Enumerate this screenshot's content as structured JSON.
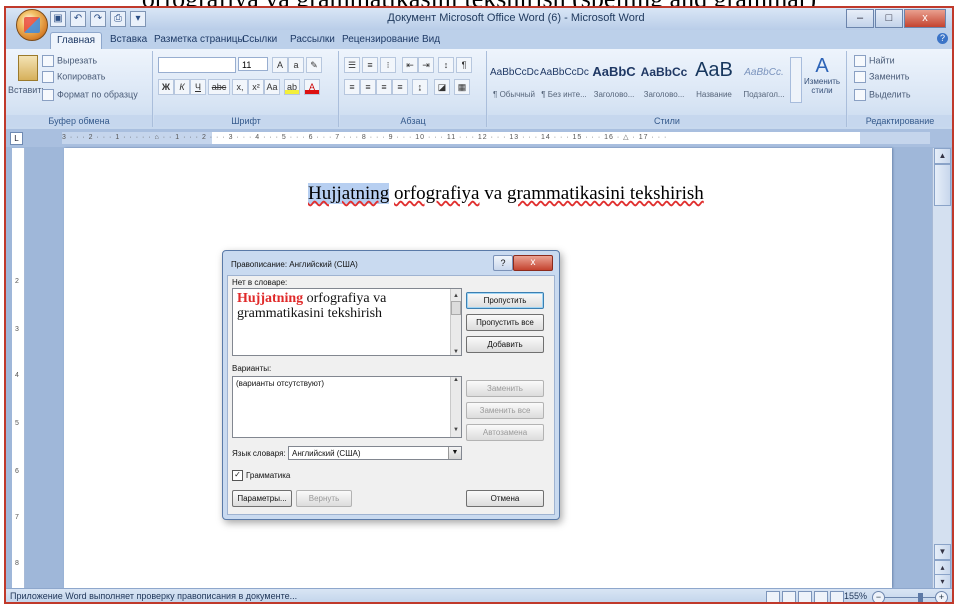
{
  "caption": "orfografiya va grammatikasini tekshirish (spelling and grammar)",
  "window": {
    "title": "Документ Microsoft Office Word (6) - Microsoft Word",
    "controls": {
      "minimize": "–",
      "maximize": "□",
      "close": "x"
    }
  },
  "tabs": [
    "Главная",
    "Вставка",
    "Разметка страницы",
    "Ссылки",
    "Рассылки",
    "Рецензирование",
    "Вид"
  ],
  "ribbon": {
    "clipboard": {
      "paste": "Вставить",
      "cut": "Вырезать",
      "copy": "Копировать",
      "format_painter": "Формат по образцу",
      "label": "Буфер обмена"
    },
    "font": {
      "font_name": "",
      "font_size": "11",
      "bold": "Ж",
      "italic": "К",
      "underline": "Ч",
      "strike": "abc",
      "subscript": "x,",
      "superscript": "x²",
      "change_case": "Aa",
      "label": "Шрифт"
    },
    "paragraph": {
      "label": "Абзац"
    },
    "styles": {
      "items": [
        {
          "sample": "AaBbCcDc",
          "name": "¶ Обычный"
        },
        {
          "sample": "AaBbCcDc",
          "name": "¶ Без инте..."
        },
        {
          "sample": "AaBbC",
          "name": "Заголово..."
        },
        {
          "sample": "AaBbCc",
          "name": "Заголово..."
        },
        {
          "sample": "AaB",
          "name": "Название"
        },
        {
          "sample": "AaBbCc.",
          "name": "Подзагол..."
        }
      ],
      "change": "Изменить стили",
      "label": "Стили"
    },
    "editing": {
      "find": "Найти",
      "replace": "Заменить",
      "select": "Выделить",
      "label": "Редактирование"
    }
  },
  "ruler": {
    "corner": "L",
    "text": "3 · · · 2 · · · 1 · · · · · ⌂ · · 1 · · · 2 · · · 3 · · · 4 · · · 5 · · · 6 · · · 7 · · · 8 · · · 9 · · · 10 · · · 11 · · · 12 · · · 13 · · · 14 · · · 15 · · · 16 · △ · 17 · · ·"
  },
  "document": {
    "heading_selected": "Hujjatning",
    "heading_rest_1": "orfografiya",
    "heading_rest_2": "va",
    "heading_rest_3": "grammatikasini tekshirish"
  },
  "dialog": {
    "title": "Правописание: Английский (США)",
    "not_in_dictionary_label": "Нет в словаре:",
    "error_word": "Hujjatning",
    "error_rest": "orfografiya va grammatikasini tekshirish",
    "suggestions_label": "Варианты:",
    "suggestions_value": "(варианты отсутствуют)",
    "language_label": "Язык словаря:",
    "language_value": "Английский (США)",
    "grammar_label": "Грамматика",
    "grammar_checked": true,
    "buttons": {
      "ignore": "Пропустить",
      "ignore_all": "Пропустить все",
      "add": "Добавить",
      "change": "Заменить",
      "change_all": "Заменить все",
      "autocorrect": "Автозамена",
      "options": "Параметры...",
      "undo": "Вернуть",
      "cancel": "Отмена"
    }
  },
  "status": {
    "text": "Приложение Word выполняет проверку правописания в документе...",
    "zoom": "155%"
  }
}
